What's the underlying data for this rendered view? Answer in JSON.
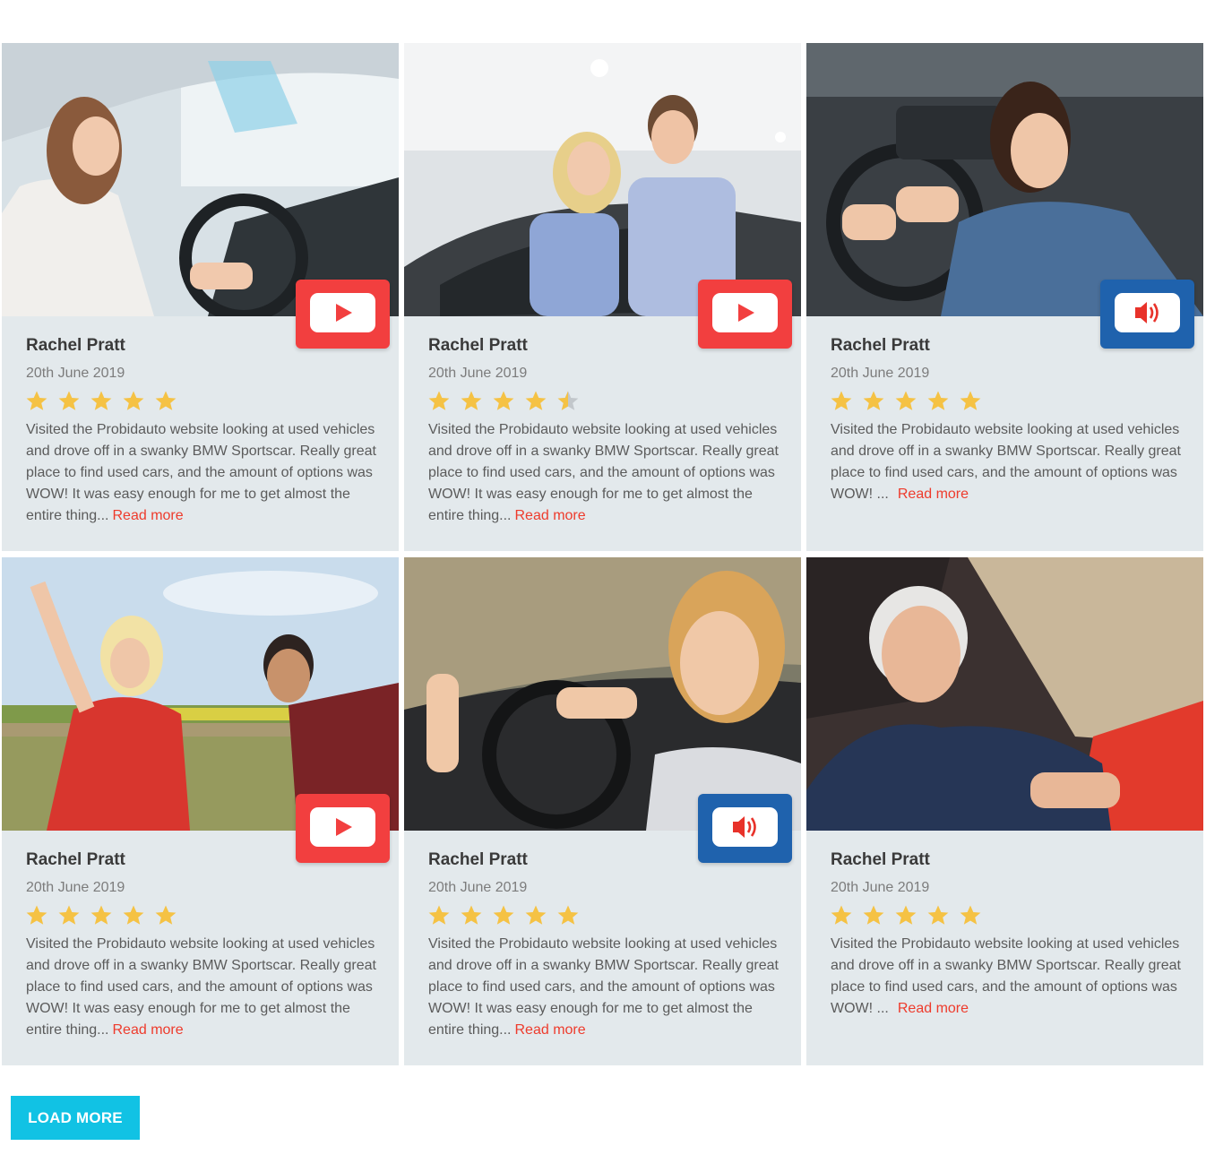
{
  "colors": {
    "card_bg": "#e3e9ec",
    "video_button": "#f23f3f",
    "audio_button": "#1f62ad",
    "star": "#f5c244",
    "read_more": "#ee3b2c",
    "load_more_bg": "#11c2e4"
  },
  "reviews": [
    {
      "name": "Rachel Pratt",
      "date": "20th June 2019",
      "rating": 5,
      "media": "video",
      "media_icon": "play-icon",
      "photo": "woman-driving-car",
      "text": "Visited the Probidauto website looking at used vehicles and drove off in a swanky BMW Sportscar. Really great place to find used cars, and the amount of options was WOW!  It was easy enough for me to get almost the entire thing...",
      "read_more": "Read more"
    },
    {
      "name": "Rachel Pratt",
      "date": "20th June 2019",
      "rating": 4.5,
      "media": "video",
      "media_icon": "play-icon",
      "photo": "couple-at-dealership",
      "text": "Visited the Probidauto website looking at used vehicles and drove off in a swanky BMW Sportscar. Really great place to find used cars, and the amount of options was WOW!  It was easy enough for me to get almost the entire thing...",
      "read_more": "Read more"
    },
    {
      "name": "Rachel Pratt",
      "date": "20th June 2019",
      "rating": 5,
      "media": "audio",
      "media_icon": "speaker-icon",
      "photo": "woman-in-car-smiling",
      "text": "Visited the Probidauto website looking at used vehicles and drove off in a swanky BMW Sportscar. Really great place to find used cars, and the amount of options was WOW!  ...",
      "read_more": "Read more"
    },
    {
      "name": "Rachel Pratt",
      "date": "20th June 2019",
      "rating": 5,
      "media": "video",
      "media_icon": "play-icon",
      "photo": "couple-celebrating-outdoors",
      "text": "Visited the Probidauto website looking at used vehicles and drove off in a swanky BMW Sportscar. Really great place to find used cars, and the amount of options was WOW!  It was easy enough for me to get almost the entire thing...",
      "read_more": "Read more"
    },
    {
      "name": "Rachel Pratt",
      "date": "20th June 2019",
      "rating": 5,
      "media": "audio",
      "media_icon": "speaker-icon",
      "photo": "woman-thumbs-up-in-car",
      "text": "Visited the Probidauto website looking at used vehicles and drove off in a swanky BMW Sportscar. Really great place to find used cars, and the amount of options was WOW!  It was easy enough for me to get almost the entire thing...",
      "read_more": "Read more"
    },
    {
      "name": "Rachel Pratt",
      "date": "20th June 2019",
      "rating": 5,
      "media": "none",
      "media_icon": "",
      "photo": "older-man-in-red-car",
      "text": "Visited the Probidauto website looking at used vehicles and drove off in a swanky BMW Sportscar. Really great place to find used cars, and the amount of options was WOW!  ...",
      "read_more": "Read more"
    }
  ],
  "load_more_label": "LOAD MORE"
}
